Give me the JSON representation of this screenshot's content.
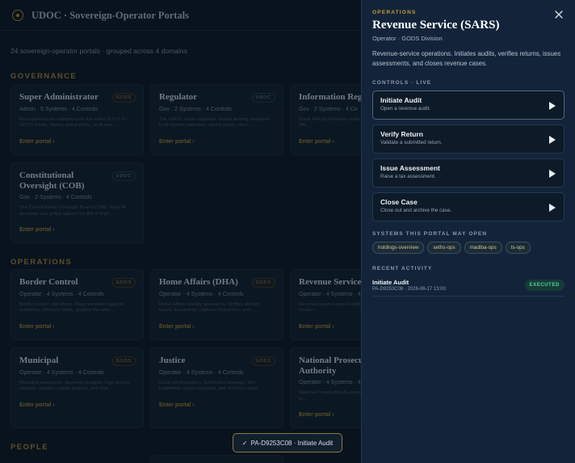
{
  "app": {
    "title": "UDOC · Sovereign-Operator Portals",
    "summary": "24 sovereign-operator portals · grouped across 4 domains",
    "link_label": "Enter portal ›"
  },
  "sections": {
    "governance": "GOVERNANCE",
    "operations": "OPERATIONS",
    "people": "PEOPLE"
  },
  "cards": {
    "super_admin": {
      "name": "Super Administrator",
      "badge": "GODS",
      "meta": "Admin · 5 Systems · 4 Controls",
      "desc": "Root governance authority over the entire G.O.D.S / UDOC estate: deploy global policy, audit eve..."
    },
    "regulator": {
      "name": "Regulator",
      "badge": "UDOC",
      "meta": "Gov · 2 Systems · 4 Controls",
      "desc": "The UDOC sector regulator. Issues binding directives to AI-system operators, opens audits, revie..."
    },
    "info_regulator": {
      "name": "Information Regu",
      "meta": "Gov · 2 Systems · 4 Co",
      "desc": "South Africa's Informati under POPIA/PAIA: oper issues PAI..."
    },
    "cob": {
      "name": "Constitutional Oversight (COB)",
      "badge": "UDOC",
      "meta": "Gov · 2 Systems · 4 Controls",
      "desc": "The Constitutional Oversight Board (COB). Tests AI decisions and policy against the Bill of Righ..."
    },
    "border": {
      "name": "Border Control",
      "badge": "GODS",
      "meta": "Operator · 4 Systems · 4 Controls",
      "desc": "Border-control operations. Flags travellers against watchlists, releases holds, updates the watc..."
    },
    "home_affairs": {
      "name": "Home Affairs (DHA)",
      "badge": "GODS",
      "meta": "Operator · 4 Systems · 4 Controls",
      "desc": "Home Affairs identity operations. Verifies identity, issues documents, captures biometrics, and ..."
    },
    "revenue": {
      "name": "Revenue Service",
      "meta": "Operator · 4 Systems · 4",
      "desc": "Revenue-service operati verifies returns, issues a closes r..."
    },
    "municipal": {
      "name": "Municipal",
      "badge": "GODS",
      "meta": "Operator · 4 Systems · 4 Controls",
      "desc": "Municipal operations. Approves budgets, logs service outages, updates capital projects, and clop..."
    },
    "justice": {
      "name": "Justice",
      "badge": "GODS",
      "meta": "Operator · 4 Systems · 4 Controls",
      "desc": "Court administration. Schedules hearings, files judgments, issues warrants, and archives cases."
    },
    "npa": {
      "name": "National Prosecu Authority",
      "meta": "Operator · 4 Systems · 4",
      "desc": "National Prosecuting Au prosecutions, requests e and w..."
    }
  },
  "drawer": {
    "eyebrow": "OPERATIONS",
    "title": "Revenue Service (SARS)",
    "subtitle": "Operator · GODS Division",
    "description": "Revenue-service operations. Initiates audits, verifies returns, issues assessments, and closes revenue cases.",
    "controls_label": "CONTROLS · LIVE",
    "controls": [
      {
        "name": "Initiate Audit",
        "desc": "Open a revenue audit."
      },
      {
        "name": "Verify Return",
        "desc": "Validate a submitted return."
      },
      {
        "name": "Issue Assessment",
        "desc": "Raise a tax assessment."
      },
      {
        "name": "Close Case",
        "desc": "Close out and archive the case."
      }
    ],
    "systems_label": "SYSTEMS THIS PORTAL MAY OPEN",
    "systems": [
      "holdings-overview",
      "seths-ops",
      "madiba-ops",
      "ts-ops"
    ],
    "activity_label": "RECENT ACTIVITY",
    "activity": [
      {
        "name": "Initiate Audit",
        "meta": "PA-D9253C08 · 2026-06-17 13:00",
        "status": "EXECUTED"
      }
    ]
  },
  "toast": {
    "check": "✓",
    "text": "PA-D9253C08 · Initiate Audit"
  },
  "colors": {
    "accent_gold": "#c59a3a",
    "status_executed": "#57d1a3",
    "badge_udoc": "#4fa3a3"
  },
  "icons": {
    "brand": "seal-icon",
    "close": "close-icon",
    "control": "play-icon",
    "toast": "check-icon"
  }
}
